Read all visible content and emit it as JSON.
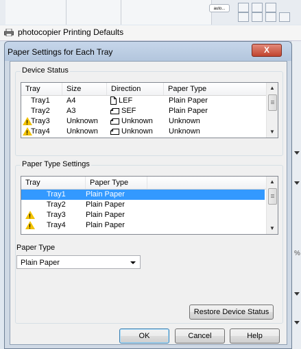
{
  "background": {
    "printing_defaults_title": "photocopier Printing Defaults",
    "top_button_label": "auto..."
  },
  "dialog": {
    "title": "Paper Settings for Each Tray",
    "close_label": "X",
    "device_status": {
      "label": "Device Status",
      "columns": [
        "Tray",
        "Size",
        "Direction",
        "Paper Type"
      ],
      "rows": [
        {
          "tray": "Tray1",
          "size": "A4",
          "direction": "LEF",
          "direction_icon": "portrait-page-icon",
          "paper_type": "Plain Paper",
          "warning": false
        },
        {
          "tray": "Tray2",
          "size": "A3",
          "direction": "SEF",
          "direction_icon": "landscape-page-icon",
          "paper_type": "Plain Paper",
          "warning": false
        },
        {
          "tray": "Tray3",
          "size": "Unknown",
          "direction": "Unknown",
          "direction_icon": "landscape-page-icon",
          "paper_type": "Unknown",
          "warning": true
        },
        {
          "tray": "Tray4",
          "size": "Unknown",
          "direction": "Unknown",
          "direction_icon": "landscape-page-icon",
          "paper_type": "Unknown",
          "warning": true
        }
      ]
    },
    "paper_type_settings": {
      "label": "Paper Type Settings",
      "columns": [
        "Tray",
        "Paper Type"
      ],
      "rows": [
        {
          "tray": "Tray1",
          "paper_type": "Plain Paper",
          "selected": true,
          "warning": false
        },
        {
          "tray": "Tray2",
          "paper_type": "Plain Paper",
          "selected": false,
          "warning": false
        },
        {
          "tray": "Tray3",
          "paper_type": "Plain Paper",
          "selected": false,
          "warning": true
        },
        {
          "tray": "Tray4",
          "paper_type": "Plain Paper",
          "selected": false,
          "warning": true
        }
      ],
      "paper_type_label": "Paper Type",
      "paper_type_value": "Plain Paper",
      "restore_label": "Restore Device Status"
    },
    "buttons": {
      "ok": "OK",
      "cancel": "Cancel",
      "help": "Help"
    }
  },
  "colors": {
    "selection": "#3399ff",
    "warning": "#f2c200",
    "close": "#c0452f"
  }
}
